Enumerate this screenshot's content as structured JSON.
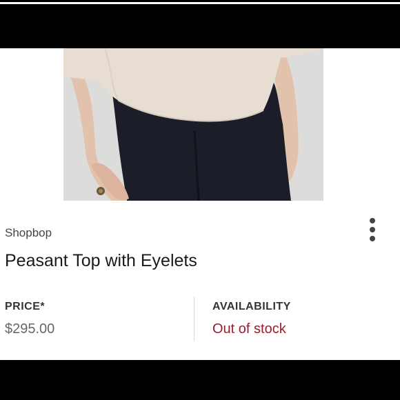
{
  "listing": {
    "brand": "Shopbop",
    "title": "Peasant Top with Eyelets",
    "price_label": "PRICE*",
    "price_value": "$295.00",
    "availability_label": "AVAILABILITY",
    "availability_value": "Out of stock"
  },
  "icons": {
    "more": "more-vertical-icon"
  },
  "colors": {
    "availability": "#9b1c2e",
    "frame": "#000000"
  }
}
